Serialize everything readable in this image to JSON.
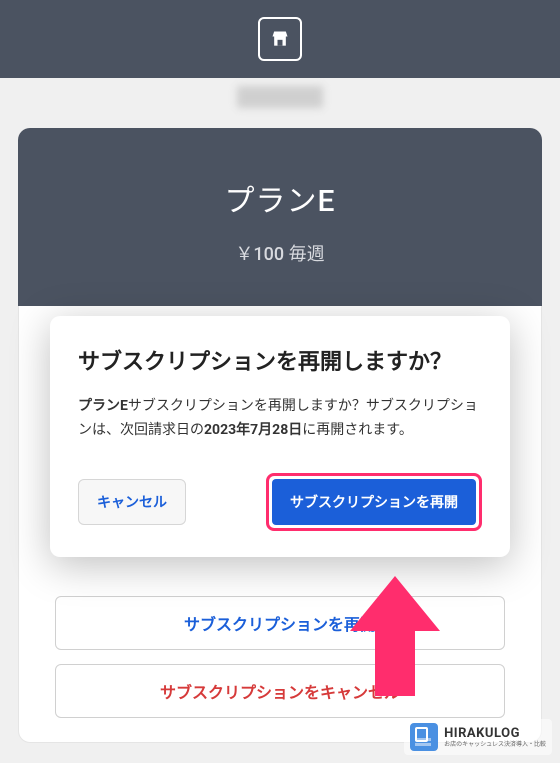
{
  "header": {
    "icon": "shop-icon"
  },
  "plan": {
    "title": "プランE",
    "price": "￥100 毎週"
  },
  "background_buttons": {
    "resume": "サブスクリプションを再開",
    "cancel": "サブスクリプションをキャンセル"
  },
  "modal": {
    "title": "サブスクリプションを再開しますか？",
    "body_plan_bold": "プランE",
    "body_part1": "サブスクリプションを再開しますか？サブスクリプションは、次回請求日の",
    "body_date_bold": "2023年7月28日",
    "body_part2": "に再開されます。",
    "cancel_label": "キャンセル",
    "confirm_label": "サブスクリプションを再開"
  },
  "watermark": {
    "name": "HIRAKULOG",
    "tagline": "お店のキャッシュレス決済導入・比較"
  }
}
